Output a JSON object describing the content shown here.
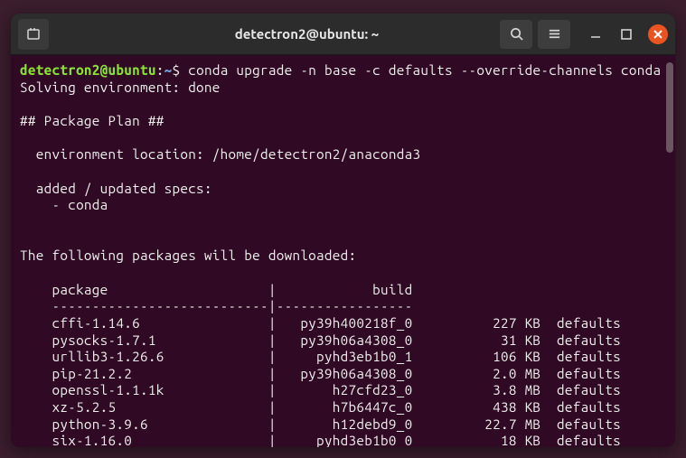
{
  "titlebar": {
    "title": "detectron2@ubuntu: ~"
  },
  "prompt": {
    "user_host": "detectron2@ubuntu",
    "sep": ":",
    "path": "~",
    "symbol": "$"
  },
  "command": "conda upgrade -n base -c defaults --override-channels conda",
  "output": {
    "solving": "Solving environment: done",
    "plan_header": "## Package Plan ##",
    "env_location": "  environment location: /home/detectron2/anaconda3",
    "specs_header": "  added / updated specs:",
    "specs_item": "    - conda",
    "download_header": "The following packages will be downloaded:",
    "table_header_package": "    package                    |            build",
    "table_divider": "    ---------------------------|-----------------",
    "packages": [
      {
        "name": "cffi-1.14.6",
        "build": "py39h400218f_0",
        "size": "227 KB",
        "channel": "defaults"
      },
      {
        "name": "pysocks-1.7.1",
        "build": "py39h06a4308_0",
        "size": "31 KB",
        "channel": "defaults"
      },
      {
        "name": "urllib3-1.26.6",
        "build": "pyhd3eb1b0_1",
        "size": "106 KB",
        "channel": "defaults"
      },
      {
        "name": "pip-21.2.2",
        "build": "py39h06a4308_0",
        "size": "2.0 MB",
        "channel": "defaults"
      },
      {
        "name": "openssl-1.1.1k",
        "build": "h27cfd23_0",
        "size": "3.8 MB",
        "channel": "defaults"
      },
      {
        "name": "xz-5.2.5",
        "build": "h7b6447c_0",
        "size": "438 KB",
        "channel": "defaults"
      },
      {
        "name": "python-3.9.6",
        "build": "h12debd9_0",
        "size": "22.7 MB",
        "channel": "defaults"
      },
      {
        "name": "six-1.16.0",
        "build": "pyhd3eb1b0_0",
        "size": "18 KB",
        "channel": "defaults"
      }
    ]
  }
}
